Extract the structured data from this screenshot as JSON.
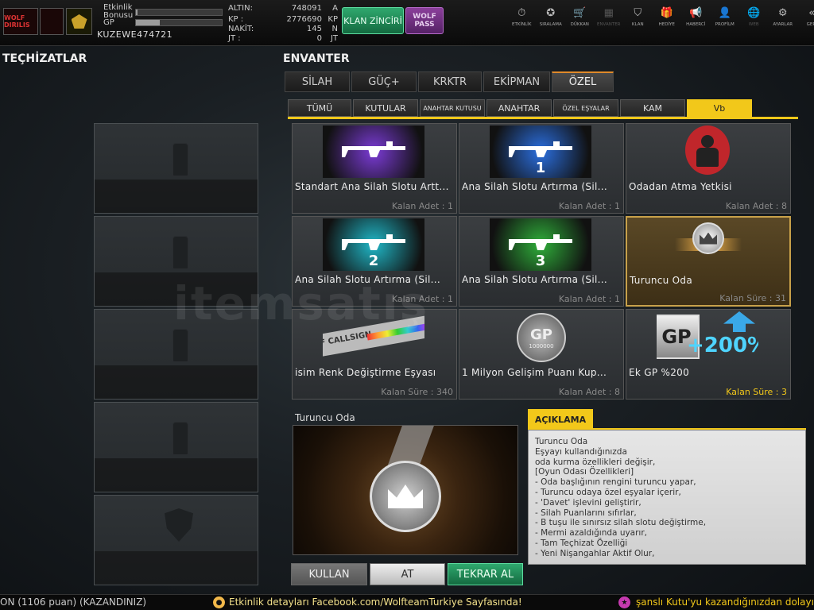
{
  "topbar": {
    "clan_badge_text": "WOLF DIRILIS",
    "etkinlik_label": "Etkinlik Bonusu",
    "gp_label": "GP",
    "etkinlik_progress": 0.02,
    "gp_progress": 0.28,
    "username": "KUZEWE474721",
    "currencies": [
      {
        "label": "ALTIN:",
        "value": "748091",
        "unit": "A"
      },
      {
        "label": "KP :",
        "value": "2776690",
        "unit": "KP"
      },
      {
        "label": "NAKİT:",
        "value": "145",
        "unit": "N"
      },
      {
        "label": "JT :",
        "value": "0",
        "unit": "JT"
      }
    ],
    "klan_button": "KLAN ZİNCİRİ",
    "wolfpass_button": "WOLF PASS",
    "nav": [
      {
        "label": "ETKİNLİK",
        "icon": "stopwatch-icon",
        "glyph": "⏱",
        "enabled": true
      },
      {
        "label": "SIRALAMA",
        "icon": "medal-icon",
        "glyph": "✪",
        "enabled": true
      },
      {
        "label": "DÜKKAN",
        "icon": "cart-icon",
        "glyph": "🛒",
        "enabled": true
      },
      {
        "label": "ENVANTER",
        "icon": "inventory-icon",
        "glyph": "▦",
        "enabled": false
      },
      {
        "label": "KLAN",
        "icon": "shield-icon",
        "glyph": "⛉",
        "enabled": true
      },
      {
        "label": "HEDİYE",
        "icon": "gift-icon",
        "glyph": "🎁",
        "enabled": true
      },
      {
        "label": "HABERCİ",
        "icon": "megaphone-icon",
        "glyph": "📢",
        "enabled": true
      },
      {
        "label": "PROFİLM",
        "icon": "profile-icon",
        "glyph": "👤",
        "enabled": true
      },
      {
        "label": "WEB",
        "icon": "globe-icon",
        "glyph": "🌐",
        "enabled": false
      },
      {
        "label": "AYARLAR",
        "icon": "gear-icon",
        "glyph": "⚙",
        "enabled": true
      },
      {
        "label": "GERİ",
        "icon": "back-icon",
        "glyph": "«",
        "enabled": true
      }
    ]
  },
  "equipment": {
    "title": "TEÇHİZATLAR",
    "slots": [
      "spray",
      "spray",
      "spray",
      "spray",
      "shield"
    ]
  },
  "inventory": {
    "title": "ENVANTER",
    "main_tabs": [
      {
        "label": "SİLAH",
        "active": false
      },
      {
        "label": "GÜÇ+",
        "active": false
      },
      {
        "label": "KRKTR",
        "active": false
      },
      {
        "label": "EKİPMAN",
        "active": false
      },
      {
        "label": "ÖZEL",
        "active": true
      }
    ],
    "sub_tabs": [
      {
        "label": "TÜMÜ",
        "active": false,
        "small": false
      },
      {
        "label": "KUTULAR",
        "active": false,
        "small": false
      },
      {
        "label": "ANAHTAR KUTUSU",
        "active": false,
        "small": true
      },
      {
        "label": "ANAHTAR",
        "active": false,
        "small": false
      },
      {
        "label": "ÖZEL EŞYALAR",
        "active": false,
        "small": true
      },
      {
        "label": "KAM",
        "active": false,
        "small": false
      },
      {
        "label": "Vb",
        "active": true,
        "small": false
      }
    ],
    "items": [
      {
        "name": "Standart Ana Silah Slotu Artt...",
        "qty": "Kalan Adet : 1",
        "type": "gun",
        "color": "#7b3bd6",
        "num": "",
        "selected": false,
        "qty_yellow": false
      },
      {
        "name": "Ana Silah Slotu Artırma (Sil...",
        "qty": "Kalan Adet : 1",
        "type": "gun",
        "color": "#2b6fe0",
        "num": "1",
        "selected": false,
        "qty_yellow": false
      },
      {
        "name": "Odadan Atma Yetkisi",
        "qty": "Kalan Adet : 8",
        "type": "kick",
        "color": "#c0262b",
        "num": "",
        "selected": false,
        "qty_yellow": false
      },
      {
        "name": "Ana Silah Slotu Artırma (Sil...",
        "qty": "Kalan Adet : 1",
        "type": "gun",
        "color": "#20b8c8",
        "num": "2",
        "selected": false,
        "qty_yellow": false
      },
      {
        "name": "Ana Silah Slotu Artırma (Sil...",
        "qty": "Kalan Adet : 1",
        "type": "gun",
        "color": "#2fae3a",
        "num": "3",
        "selected": false,
        "qty_yellow": false
      },
      {
        "name": "Turuncu Oda",
        "qty": "Kalan Süre : 31",
        "type": "room",
        "color": "#d89a3a",
        "num": "",
        "selected": true,
        "qty_yellow": false
      },
      {
        "name": "isim Renk Değiştirme Eşyası",
        "qty": "Kalan Süre : 340",
        "type": "callsign",
        "color": "#888888",
        "num": "",
        "selected": false,
        "qty_yellow": false
      },
      {
        "name": "1 Milyon Gelişim Puanı Kup...",
        "qty": "Kalan Adet : 8",
        "type": "gpcoin",
        "color": "#aaaaaa",
        "num": "",
        "selected": false,
        "qty_yellow": false
      },
      {
        "name": "Ek GP %200",
        "qty": "Kalan Süre : 3",
        "type": "gpplus",
        "color": "#3aa8e8",
        "num": "",
        "selected": false,
        "qty_yellow": true
      }
    ],
    "item_art_text": {
      "callsign": "OR OF CALLSIGN",
      "gpcoin_top": "GP",
      "gpcoin_bottom": "1000000",
      "gpplus_badge": "GP",
      "gpplus_text": "+200%"
    }
  },
  "detail": {
    "title": "Turuncu Oda",
    "desc_tab": "AÇIKLAMA",
    "desc_lines": [
      "Turuncu Oda",
      "Eşyayı kullandığınızda",
      "oda kurma özellikleri değişir,",
      "[Oyun Odası Özellikleri]",
      "- Oda başlığının rengini turuncu yapar,",
      "- Turuncu odaya özel eşyalar içerir,",
      "- 'Davet' işlevini geliştirir,",
      "- Silah Puanlarını sıfırlar,",
      "- B tuşu ile sınırsız silah slotu değiştirme,",
      "- Mermi azaldığında uyarır,",
      "- Tam Teçhizat Özelliği",
      "- Yeni Nişangahlar Aktif Olur,"
    ],
    "buttons": {
      "kullan": "KULLAN",
      "at": "AT",
      "tekrar": "TEKRAR AL"
    }
  },
  "ticker": {
    "msg1": "ON (1106 puan) (KAZANDINIZ)",
    "msg2": "Etkinlik detayları Facebook.com/WolfteamTurkiye Sayfasında!",
    "msg3": "şanslı Kutu'yu kazandığınızdan dolayı",
    "colors": {
      "msg1": "#cccccc",
      "msg2": "#f2e08a",
      "msg3": "#f2c81a"
    }
  },
  "watermark": "itemsatış"
}
